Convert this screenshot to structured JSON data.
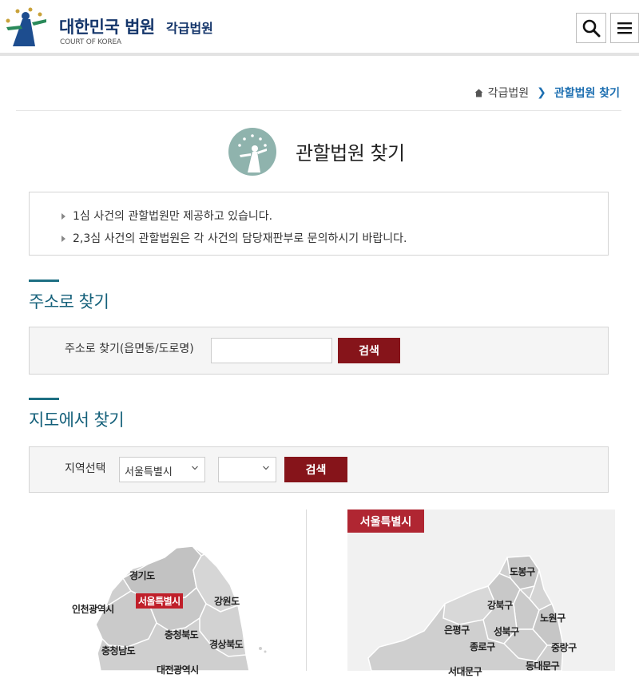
{
  "header": {
    "logo_title": "대한민국 법원",
    "logo_sub": "각급법원",
    "logo_eng": "COURT OF KOREA",
    "search_icon": "search-icon",
    "menu_icon": "menu-icon"
  },
  "breadcrumb": {
    "home_icon": "home-icon",
    "parent": "각급법원",
    "separator": "❯",
    "current": "관할법원 찾기"
  },
  "page": {
    "title": "관할법원 찾기",
    "notices": [
      "1심 사건의 관할법원만 제공하고 있습니다.",
      "2,3심 사건의 관할법원은 각 사건의 담당재판부로 문의하시기 바랍니다."
    ]
  },
  "address_search": {
    "section_title": "주소로 찾기",
    "label": "주소로 찾기(읍면동/도로명)",
    "input_value": "",
    "button": "검색"
  },
  "map_search": {
    "section_title": "지도에서 찾기",
    "label": "지역선택",
    "region_selected": "서울특별시",
    "district_selected": "",
    "button": "검색",
    "left_map_labels": [
      "경기도",
      "서울특별시",
      "강원도",
      "인천광역시",
      "충청북도",
      "경상북도",
      "충청남도",
      "대전광역시"
    ],
    "right_region": "서울특별시",
    "right_map_labels": [
      "도봉구",
      "강북구",
      "노원구",
      "은평구",
      "성북구",
      "종로구",
      "중랑구",
      "동대문구",
      "서대문구"
    ]
  },
  "colors": {
    "brand_navy": "#15366b",
    "accent_teal": "#14607a",
    "button_red": "#86141a",
    "highlight_red": "#c01f2a"
  }
}
